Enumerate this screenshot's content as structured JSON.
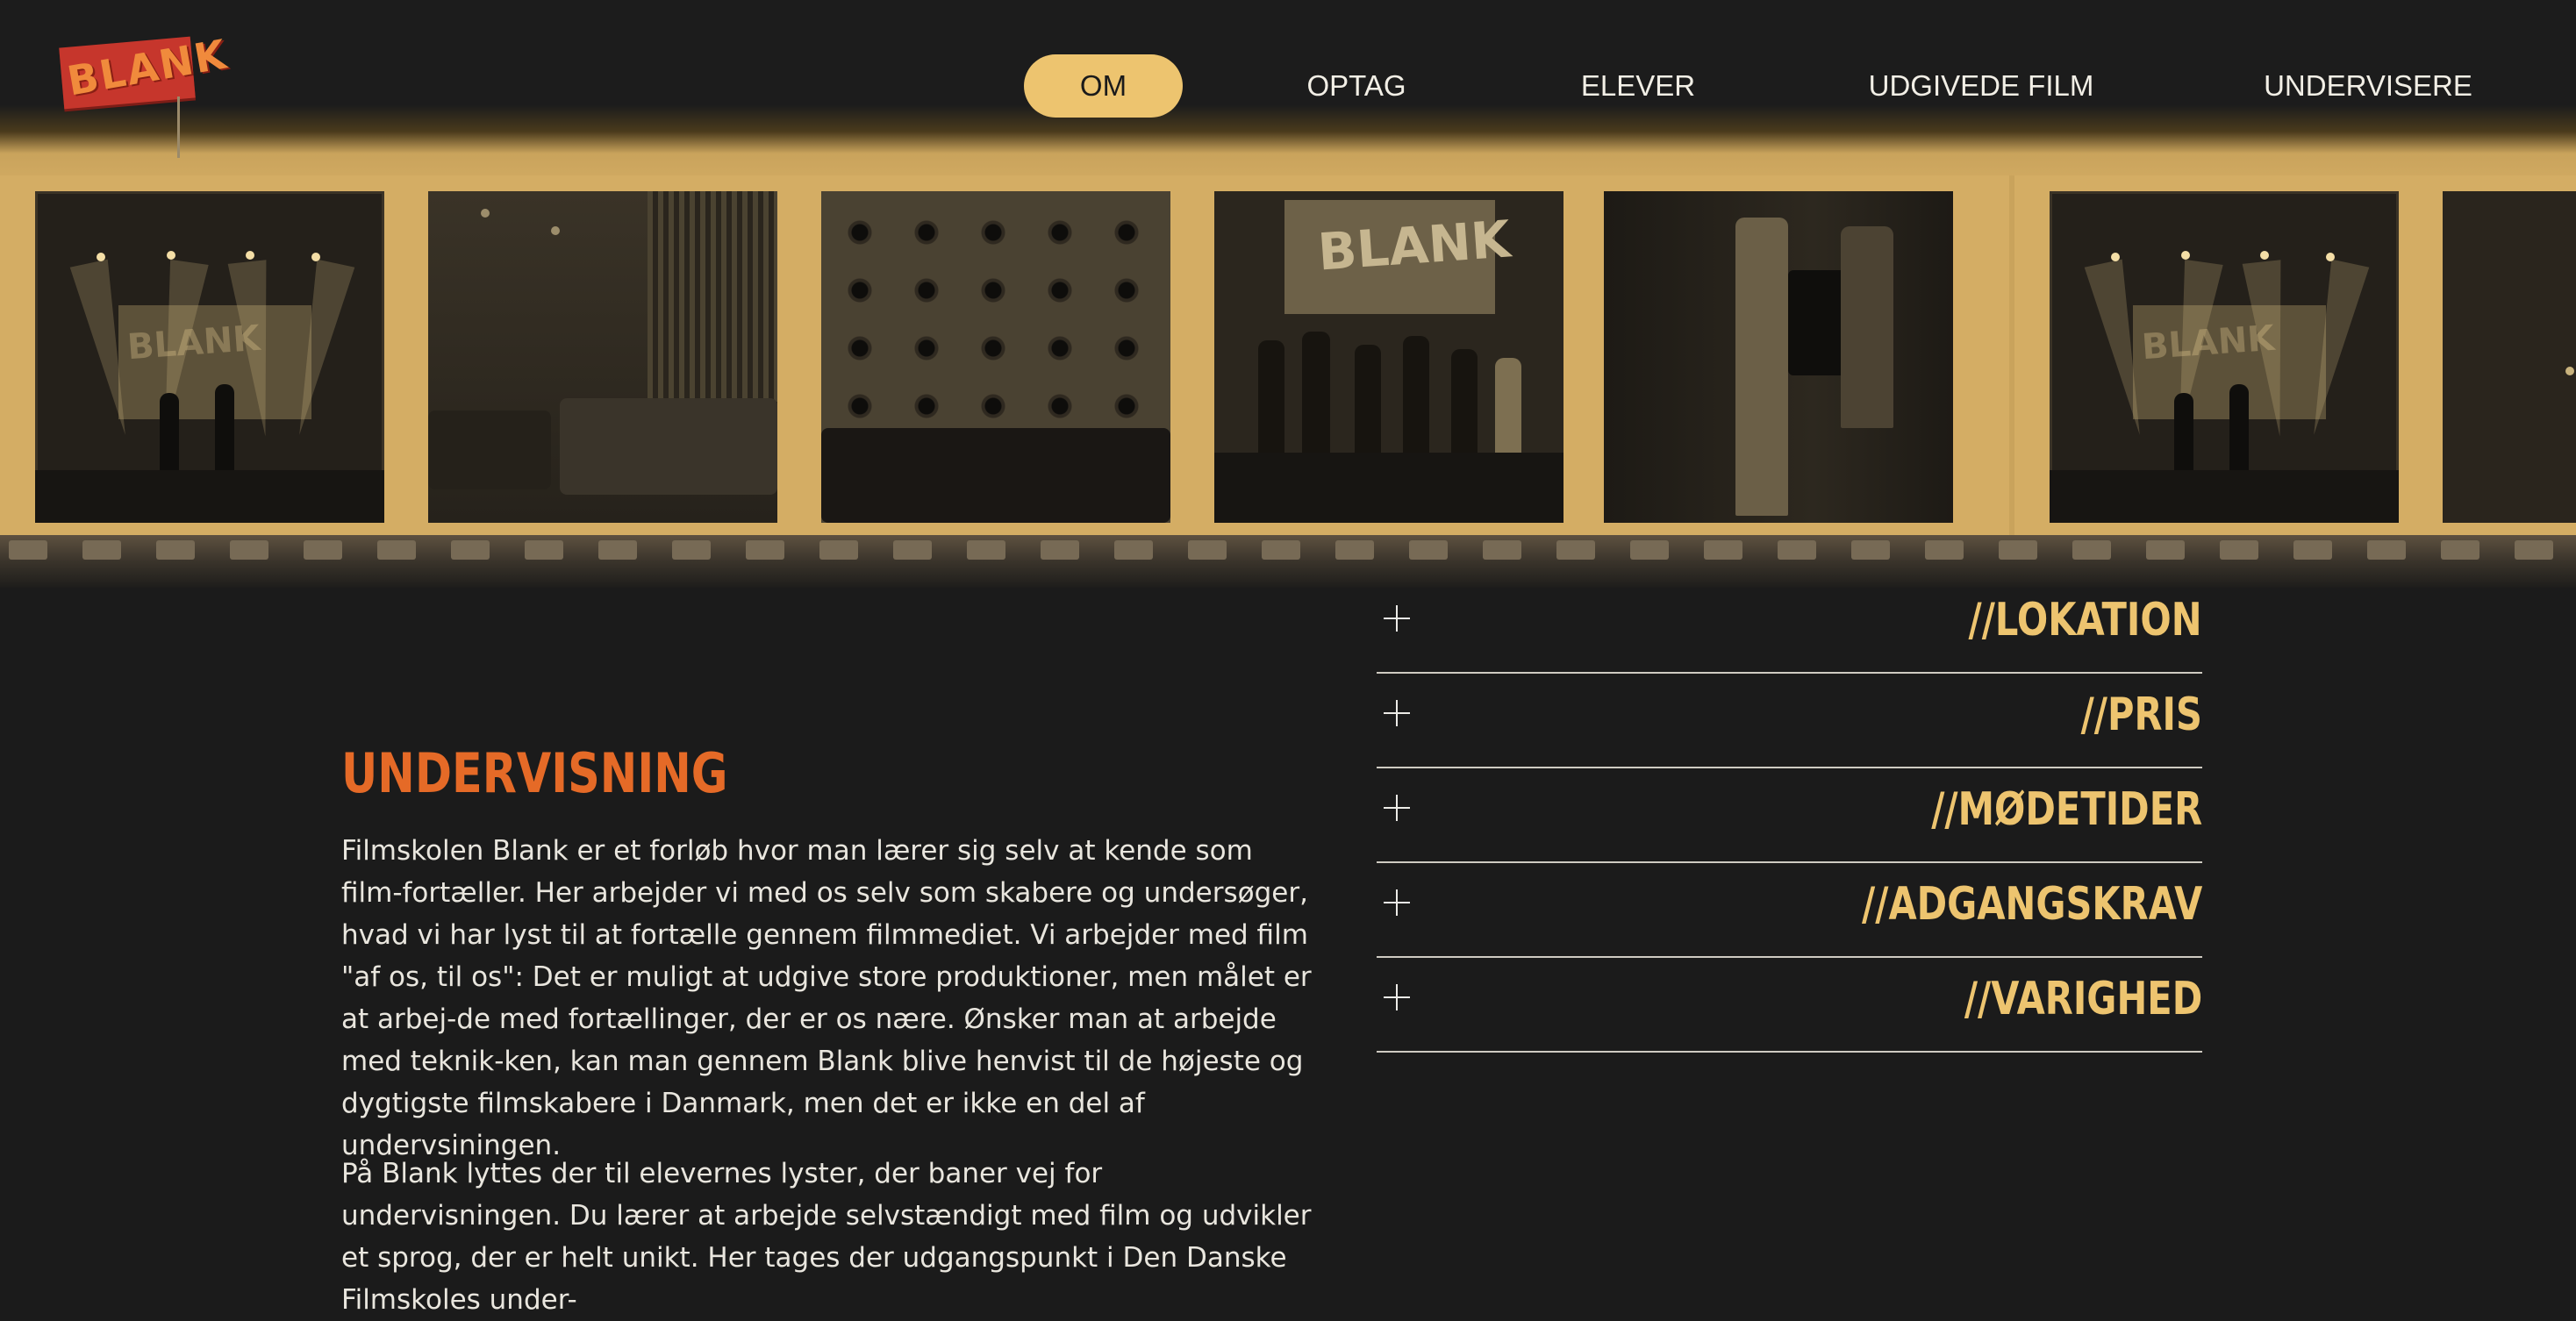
{
  "brand": {
    "logo_text": "BLANK"
  },
  "nav": {
    "items": [
      {
        "label": "OM",
        "active": true
      },
      {
        "label": "OPTAG",
        "active": false
      },
      {
        "label": "ELEVER",
        "active": false
      },
      {
        "label": "UDGIVEDE FILM",
        "active": false
      },
      {
        "label": "UNDERVISERE",
        "active": false
      }
    ]
  },
  "filmstrip": {
    "frames": [
      {
        "subject": "stage-with-speakers",
        "sign_text": "BLANK"
      },
      {
        "subject": "cinema-room"
      },
      {
        "subject": "studded-wall-audience"
      },
      {
        "subject": "group-on-stage",
        "sign_text": "BLANK"
      },
      {
        "subject": "camera-operator"
      },
      {
        "subject": "stage-with-speakers",
        "sign_text": "BLANK"
      },
      {
        "subject": "partial-frame"
      }
    ]
  },
  "main": {
    "title": "UNDERVISNING",
    "paragraphs": [
      "Filmskolen Blank er et forløb hvor man lærer sig selv at kende som film-fortæller. Her arbejder vi med os selv som skabere og undersøger, hvad vi har lyst til at fortælle gennem filmmediet. Vi arbejder med film \"af os, til os\": Det er muligt at udgive store produktioner, men målet er at arbej-de med fortællinger, der er os nære. Ønsker man at arbejde med teknik-ken, kan man gennem Blank blive henvist til de højeste og dygtigste filmskabere i Danmark, men det er ikke en del af undervsiningen.",
      "På Blank lyttes der til elevernes lyster, der baner vej for undervisningen. Du lærer at arbejde selvstændigt med film og udvikler et sprog, der er helt unikt. Her tages der udgangspunkt i Den Danske Filmskoles under-"
    ]
  },
  "accordion": {
    "items": [
      {
        "label": "//LOKATION",
        "expanded": false
      },
      {
        "label": "//PRIS",
        "expanded": false
      },
      {
        "label": "//MØDETIDER",
        "expanded": false
      },
      {
        "label": "//ADGANGSKRAV",
        "expanded": false
      },
      {
        "label": "//VARIGHED",
        "expanded": false
      }
    ]
  },
  "colors": {
    "background": "#1b1b1b",
    "accent_yellow": "#edc46f",
    "title_orange": "#e56a27",
    "logo_red": "#c6362c"
  }
}
